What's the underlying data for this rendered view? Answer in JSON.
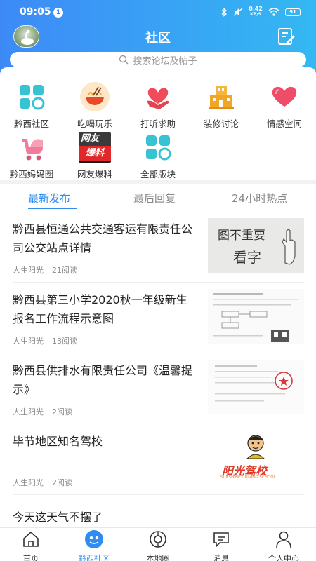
{
  "status_bar": {
    "time": "09:05",
    "notification_count": "1",
    "net_speed_value": "0.42",
    "net_speed_unit": "KB/S",
    "battery": "91"
  },
  "header": {
    "title": "社区"
  },
  "search": {
    "placeholder": "搜索论坛及帖子"
  },
  "categories": [
    {
      "label": "黔西社区",
      "icon": "grid-blocks-icon"
    },
    {
      "label": "吃喝玩乐",
      "icon": "noodle-bowl-icon"
    },
    {
      "label": "打听求助",
      "icon": "heart-hand-icon"
    },
    {
      "label": "装修讨论",
      "icon": "building-icon"
    },
    {
      "label": "情感空间",
      "icon": "heart-icon"
    },
    {
      "label": "黔西妈妈圈",
      "icon": "stroller-icon"
    },
    {
      "label": "网友爆料",
      "icon": "netizen-news-icon",
      "icon_text_top": "网友",
      "icon_text_bottom": "爆料"
    },
    {
      "label": "全部版块",
      "icon": "grid-blocks-icon"
    }
  ],
  "tabs": [
    {
      "label": "最新发布",
      "active": true
    },
    {
      "label": "最后回复",
      "active": false
    },
    {
      "label": "24小时热点",
      "active": false
    }
  ],
  "posts": [
    {
      "title": "黔西县恒通公共交通客运有限责任公司公交站点详情",
      "author": "人生阳光",
      "reads": "21阅读",
      "thumb_text_line1": "图不重要",
      "thumb_text_line2": "看字"
    },
    {
      "title": "黔西县第三小学2020秋一年级新生报名工作流程示意图",
      "author": "人生阳光",
      "reads": "13阅读"
    },
    {
      "title": "黔西县供排水有限责任公司《温馨提示》",
      "author": "人生阳光",
      "reads": "2阅读"
    },
    {
      "title": "毕节地区知名驾校",
      "author": "人生阳光",
      "reads": "2阅读",
      "thumb_text": "阳光驾校",
      "thumb_subtext": "SUNSHINE DRIVING SCHOOL"
    },
    {
      "title": "今天这天气不摆了"
    }
  ],
  "bottom_nav": [
    {
      "label": "首页",
      "active": false
    },
    {
      "label": "黔西社区",
      "active": true
    },
    {
      "label": "本地圈",
      "active": false
    },
    {
      "label": "消息",
      "active": false
    },
    {
      "label": "个人中心",
      "active": false
    }
  ],
  "colors": {
    "header_start": "#3d8af7",
    "header_end": "#34b8f2",
    "accent": "#2f8cf0",
    "text": "#222222",
    "muted": "#888888"
  }
}
